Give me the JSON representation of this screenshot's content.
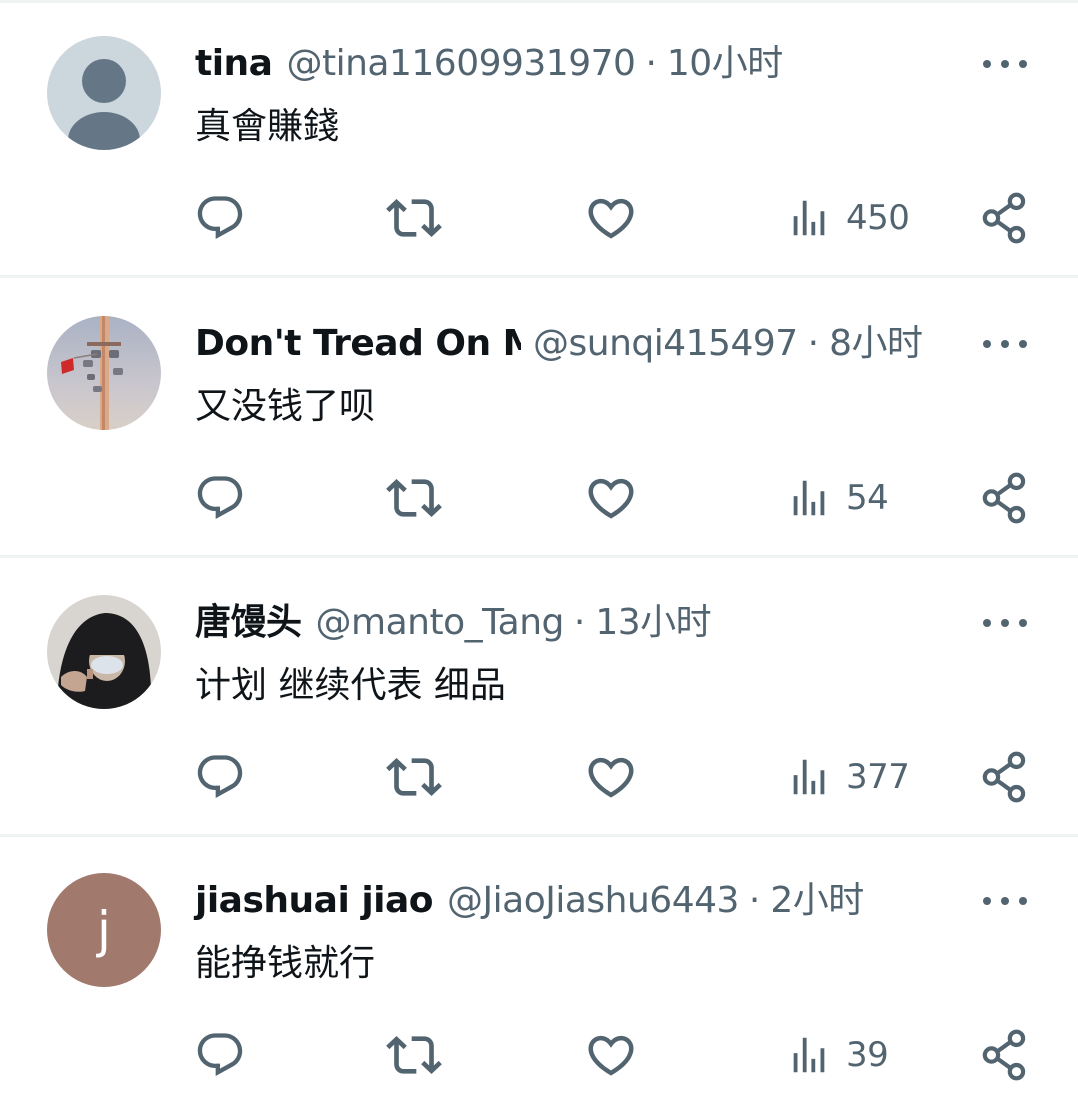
{
  "replies": [
    {
      "display_name": "tina",
      "handle": "@tina11609931970",
      "separator": "·",
      "time": "10小时",
      "text": "真會賺錢",
      "views": "450",
      "avatar": {
        "type": "default-silhouette",
        "bg_color": "#ccd6dd",
        "fg_color": "#657786"
      }
    },
    {
      "display_name": "Don't Tread On Me",
      "handle": "@sunqi415497",
      "separator": "·",
      "time": "8小时",
      "text": "又没钱了呗",
      "views": "54",
      "avatar": {
        "type": "photo-lamp-post-with-cameras-and-flag"
      }
    },
    {
      "display_name": "唐馒头",
      "handle": "@manto_Tang",
      "separator": "·",
      "time": "13小时",
      "text": "计划 继续代表 细品",
      "views": "377",
      "avatar": {
        "type": "photo-hooded-person-masked"
      }
    },
    {
      "display_name": "jiashuai jiao",
      "handle": "@JiaoJiashu6443",
      "separator": "·",
      "time": "2小时",
      "text": "能挣钱就行",
      "views": "39",
      "avatar": {
        "type": "letter",
        "letter": "j",
        "bg_color": "#a1796d"
      }
    }
  ],
  "icons": {
    "reply": "reply-bubble-icon",
    "retweet": "retweet-icon",
    "like": "heart-icon",
    "views": "views-bar-chart-icon",
    "share": "share-icon",
    "more": "more-dots-icon"
  },
  "colors": {
    "text": "#0f1419",
    "secondary": "#536471",
    "divider": "#eff3f4",
    "background": "#ffffff"
  }
}
